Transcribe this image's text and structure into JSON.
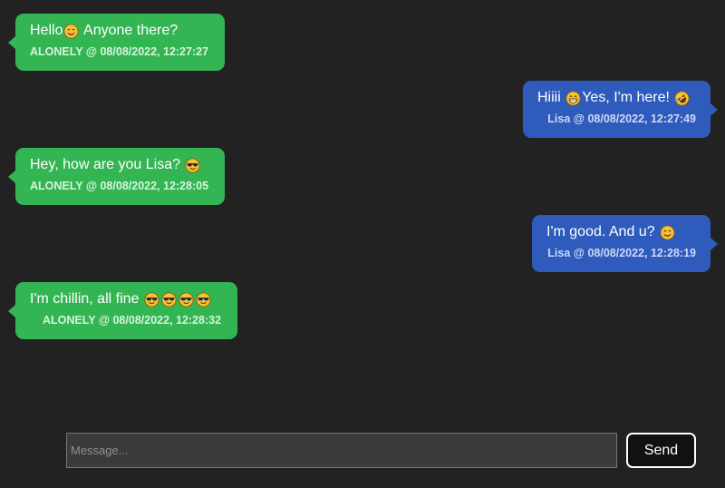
{
  "messages": [
    {
      "side": "left",
      "parts": [
        "Hello",
        "",
        " Anyone there?"
      ],
      "meta": "ALONELY @ 08/08/2022, 12:27:27"
    },
    {
      "side": "right",
      "parts": [
        "Hiiii ",
        "",
        "Yes, I'm here! ",
        ""
      ],
      "meta": "Lisa @ 08/08/2022, 12:27:49"
    },
    {
      "side": "left",
      "parts": [
        "Hey, how are you Lisa? ",
        ""
      ],
      "meta": "ALONELY @ 08/08/2022, 12:28:05"
    },
    {
      "side": "right",
      "parts": [
        "I'm good. And u? ",
        ""
      ],
      "meta": "Lisa @ 08/08/2022, 12:28:19"
    },
    {
      "side": "left",
      "parts": [
        "I'm chillin, all fine ",
        ""
      ],
      "meta": "ALONELY @ 08/08/2022, 12:28:32"
    }
  ],
  "icons": {
    "smile": "smiling-face-icon",
    "grin": "grinning-face-icon",
    "rofl": "rolling-laughing-face-icon",
    "cool": "sunglasses-face-icon"
  },
  "composer": {
    "placeholder": "Message...",
    "value": "",
    "send_label": "Send"
  },
  "colors": {
    "background": "#222222",
    "incoming_bubble": "#33b554",
    "outgoing_bubble": "#2f5bbc",
    "input_bg": "#3b3b3b"
  }
}
